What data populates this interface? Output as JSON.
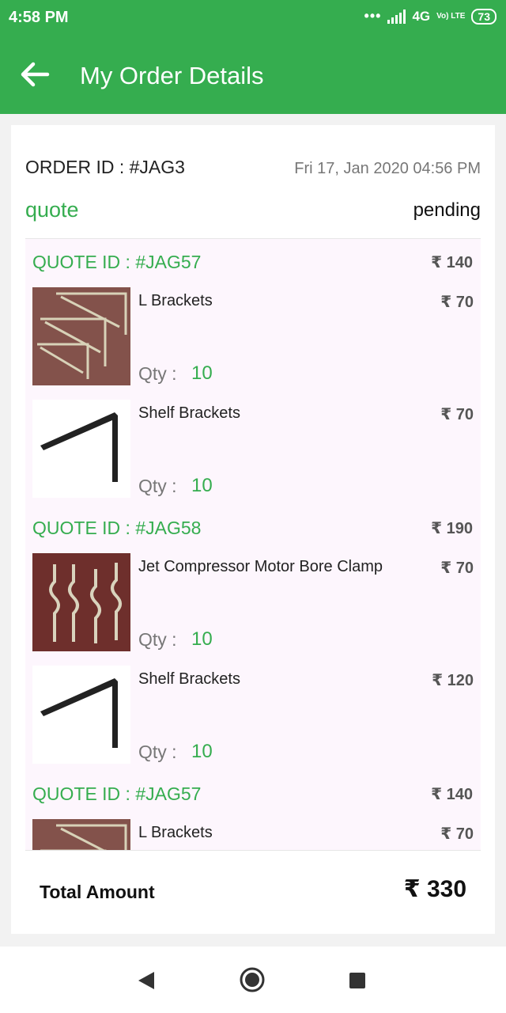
{
  "status_bar": {
    "time": "4:58 PM",
    "network": "4G",
    "volte": "Vo) LTE",
    "battery": "73"
  },
  "app_bar": {
    "title": "My Order Details",
    "back_icon": "arrow-left-icon"
  },
  "order": {
    "id_label": "ORDER ID : #JAG3",
    "date": "Fri 17, Jan 2020 04:56 PM",
    "type": "quote",
    "status": "pending"
  },
  "quotes": [
    {
      "id_label": "QUOTE ID : #JAG57",
      "total": "₹ 140",
      "items": [
        {
          "name": "L Brackets",
          "price": "₹ 70",
          "qty_label": "Qty :",
          "qty": "10",
          "image": "l-brackets-image"
        },
        {
          "name": "Shelf Brackets",
          "price": "₹ 70",
          "qty_label": "Qty :",
          "qty": "10",
          "image": "shelf-bracket-image"
        }
      ]
    },
    {
      "id_label": "QUOTE ID : #JAG58",
      "total": "₹ 190",
      "items": [
        {
          "name": "Jet Compressor Motor Bore Clamp",
          "price": "₹ 70",
          "qty_label": "Qty :",
          "qty": "10",
          "image": "clamp-image"
        },
        {
          "name": "Shelf Brackets",
          "price": "₹ 120",
          "qty_label": "Qty :",
          "qty": "10",
          "image": "shelf-bracket-image"
        }
      ]
    },
    {
      "id_label": "QUOTE ID : #JAG57",
      "total": "₹ 140",
      "items": [
        {
          "name": "L Brackets",
          "price": "₹ 70",
          "qty_label": "",
          "qty": "",
          "image": "l-brackets-image"
        }
      ]
    }
  ],
  "summary": {
    "total_label": "Total Amount",
    "total_value": "₹ 330"
  },
  "colors": {
    "accent": "#35ad4f",
    "list_background": "#fdf6fd"
  }
}
